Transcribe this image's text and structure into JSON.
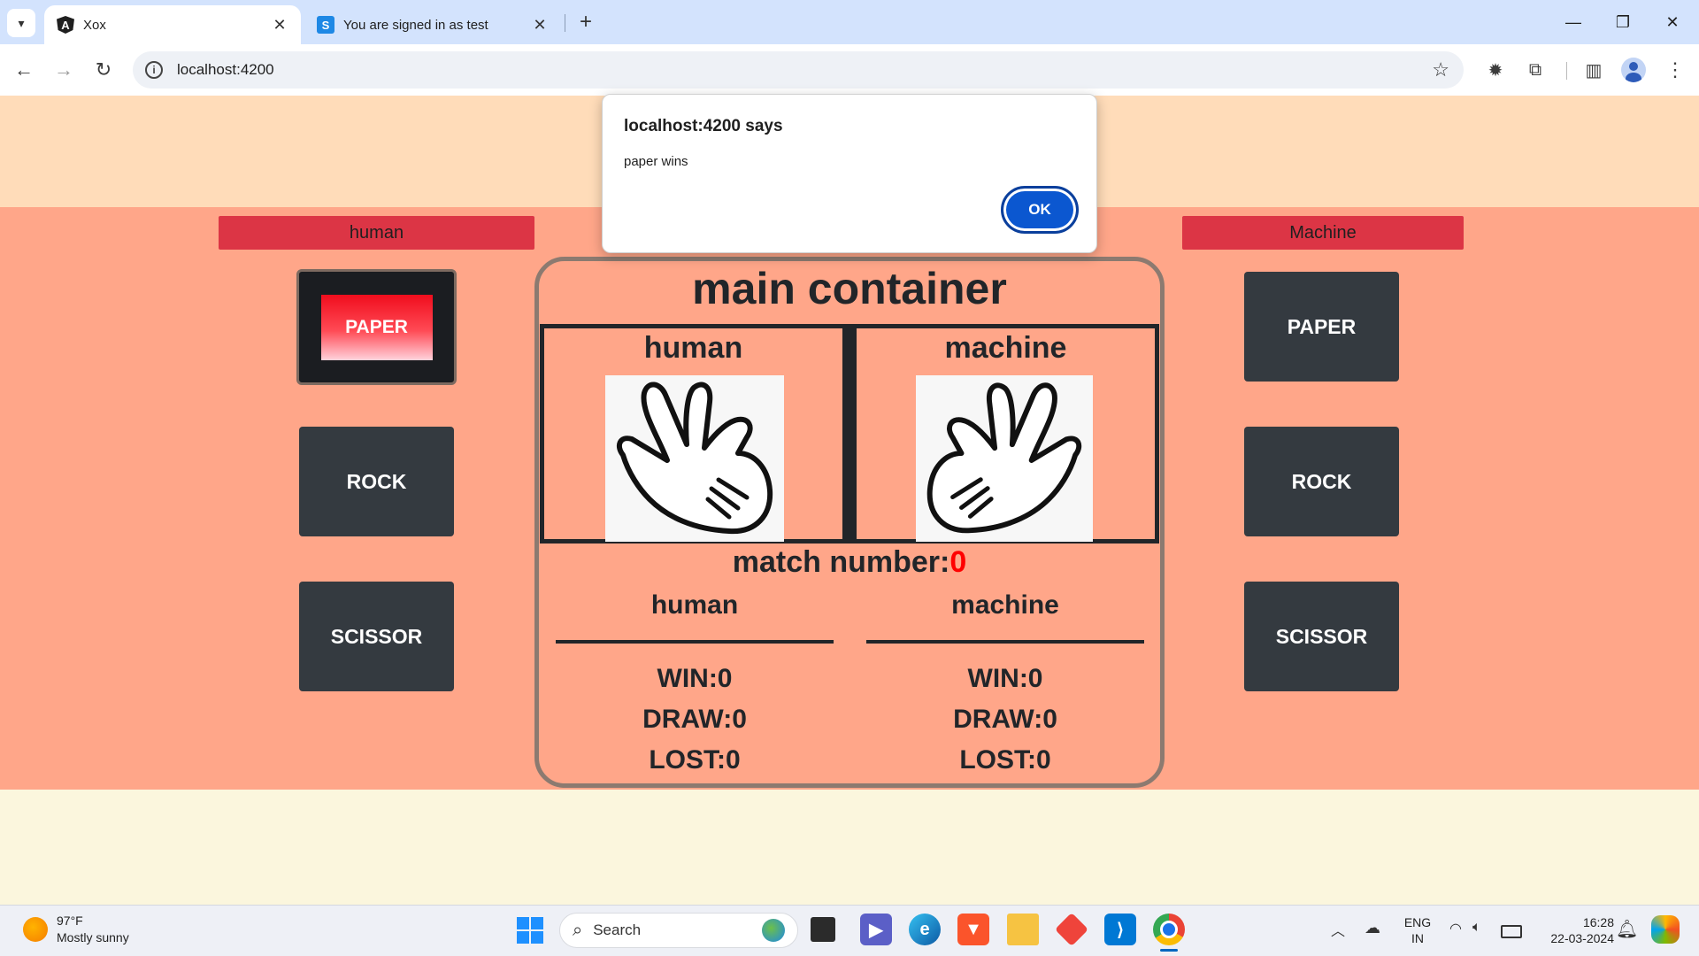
{
  "browser": {
    "tabs": [
      {
        "title": "Xox",
        "favicon": "angular-icon",
        "active": true
      },
      {
        "title": "You are signed in as test",
        "favicon": "s-icon",
        "active": false
      }
    ],
    "url": "localhost:4200"
  },
  "page": {
    "human_header": "human",
    "machine_header": "Machine",
    "human_buttons": [
      "PAPER",
      "ROCK",
      "SCISSOR"
    ],
    "machine_buttons": [
      "PAPER",
      "ROCK",
      "SCISSOR"
    ],
    "main_title": "main container",
    "human_label": "human",
    "machine_label": "machine",
    "match_label": "match number:",
    "match_number": "0",
    "human_score_head": "human",
    "machine_score_head": "machine",
    "human_stats": {
      "win": "WIN:0",
      "draw": "DRAW:0",
      "lost": "LOST:0"
    },
    "machine_stats": {
      "win": "WIN:0",
      "draw": "DRAW:0",
      "lost": "LOST:0"
    }
  },
  "dialog": {
    "title": "localhost:4200 says",
    "message": "paper wins",
    "ok_label": "OK"
  },
  "taskbar": {
    "weather_temp": "97°F",
    "weather_desc": "Mostly sunny",
    "search_placeholder": "Search",
    "lang": "ENG",
    "region": "IN",
    "time": "16:28",
    "date": "22-03-2024"
  },
  "colors": {
    "page_top": "#ffdcb9",
    "page_mid": "#ffa689",
    "header_red": "#dc3545",
    "button_dark": "#343a40",
    "dialog_ok": "#0b57d0"
  }
}
